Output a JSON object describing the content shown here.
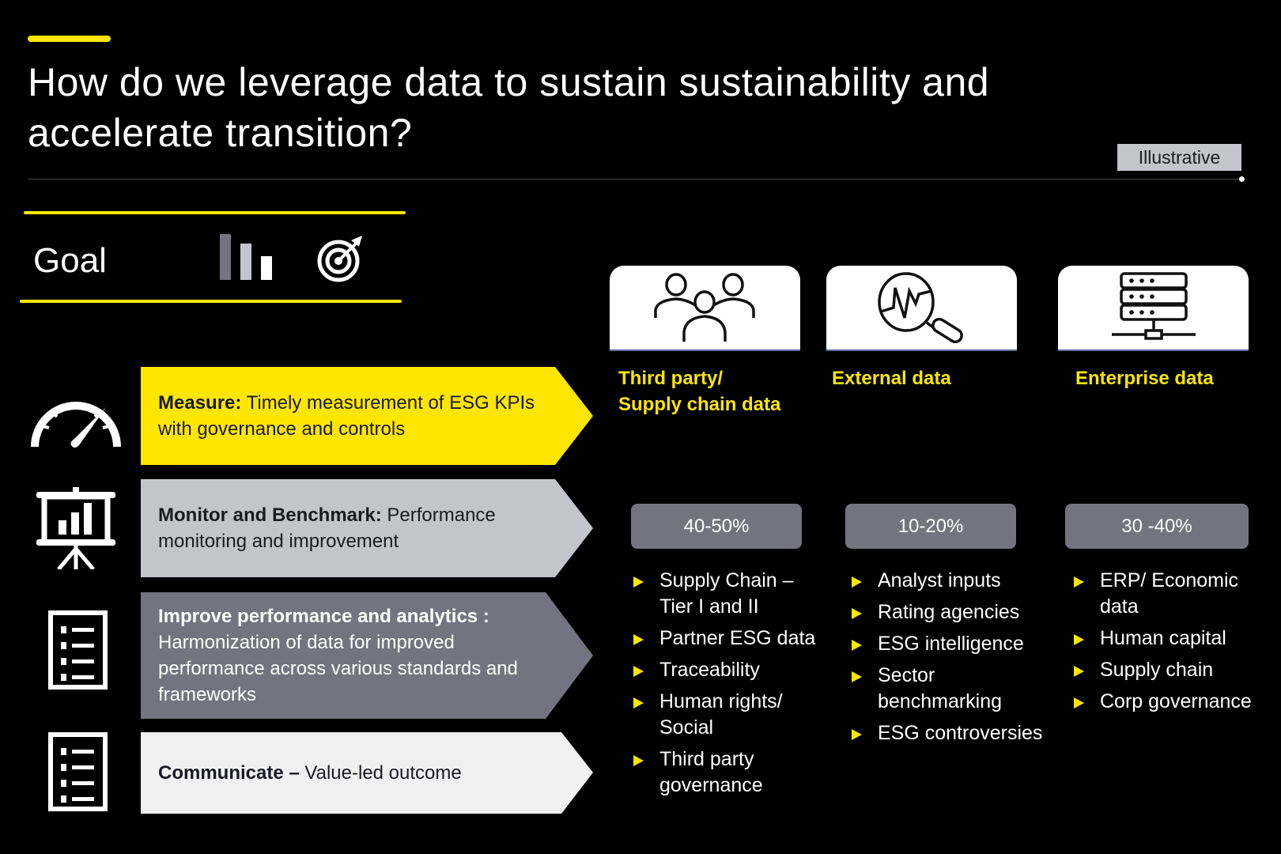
{
  "header": {
    "title_line1": "How do we leverage data to sustain sustainability and",
    "title_line2": "accelerate transition?",
    "badge": "Illustrative"
  },
  "goal": {
    "label": "Goal",
    "icons": [
      "bar-chart-icon",
      "target-icon"
    ]
  },
  "stages": [
    {
      "bold": "Measure:",
      "text": " Timely measurement of ESG KPIs with governance and controls",
      "icon": "speedometer-icon",
      "color": "#ffe600",
      "text_color": "#1a1a24"
    },
    {
      "bold": "Monitor and Benchmark:",
      "text": " Performance monitoring and improvement",
      "icon": "presentation-chart-icon",
      "color": "#c4c4cd",
      "text_color": "#1a1a24"
    },
    {
      "bold": "Improve performance and analytics :",
      "text": " Harmonization of data for improved performance across various standards and frameworks",
      "icon": "checklist-icon",
      "color": "#747480",
      "text_color": "#ffffff"
    },
    {
      "bold": "Communicate –",
      "text": " Value-led outcome",
      "icon": "checklist-icon",
      "color": "#f0f0f0",
      "text_color": "#1a1a24"
    }
  ],
  "sources": [
    {
      "title_line1": "Third party/",
      "title_line2": "Supply chain data",
      "icon": "people-group-icon",
      "share": "40-50%",
      "items": [
        "Supply Chain – Tier I and II",
        "Partner ESG data",
        "Traceability",
        "Human rights/ Social",
        "Third party governance"
      ]
    },
    {
      "title_line1": "External data",
      "title_line2": "",
      "icon": "magnifier-chart-icon",
      "share": "10-20%",
      "items": [
        "Analyst inputs",
        "Rating agencies",
        "ESG intelligence",
        "Sector benchmarking",
        "ESG controversies"
      ]
    },
    {
      "title_line1": "Enterprise data",
      "title_line2": "",
      "icon": "server-network-icon",
      "share": "30 -40%",
      "items": [
        "ERP/ Economic data",
        "Human capital",
        "Supply chain",
        "Corp governance"
      ]
    }
  ],
  "colors": {
    "accent": "#ffe600",
    "grey_dark": "#747480",
    "grey_light": "#c4c4cd",
    "off_white": "#f0f0f0",
    "background": "#000000"
  }
}
